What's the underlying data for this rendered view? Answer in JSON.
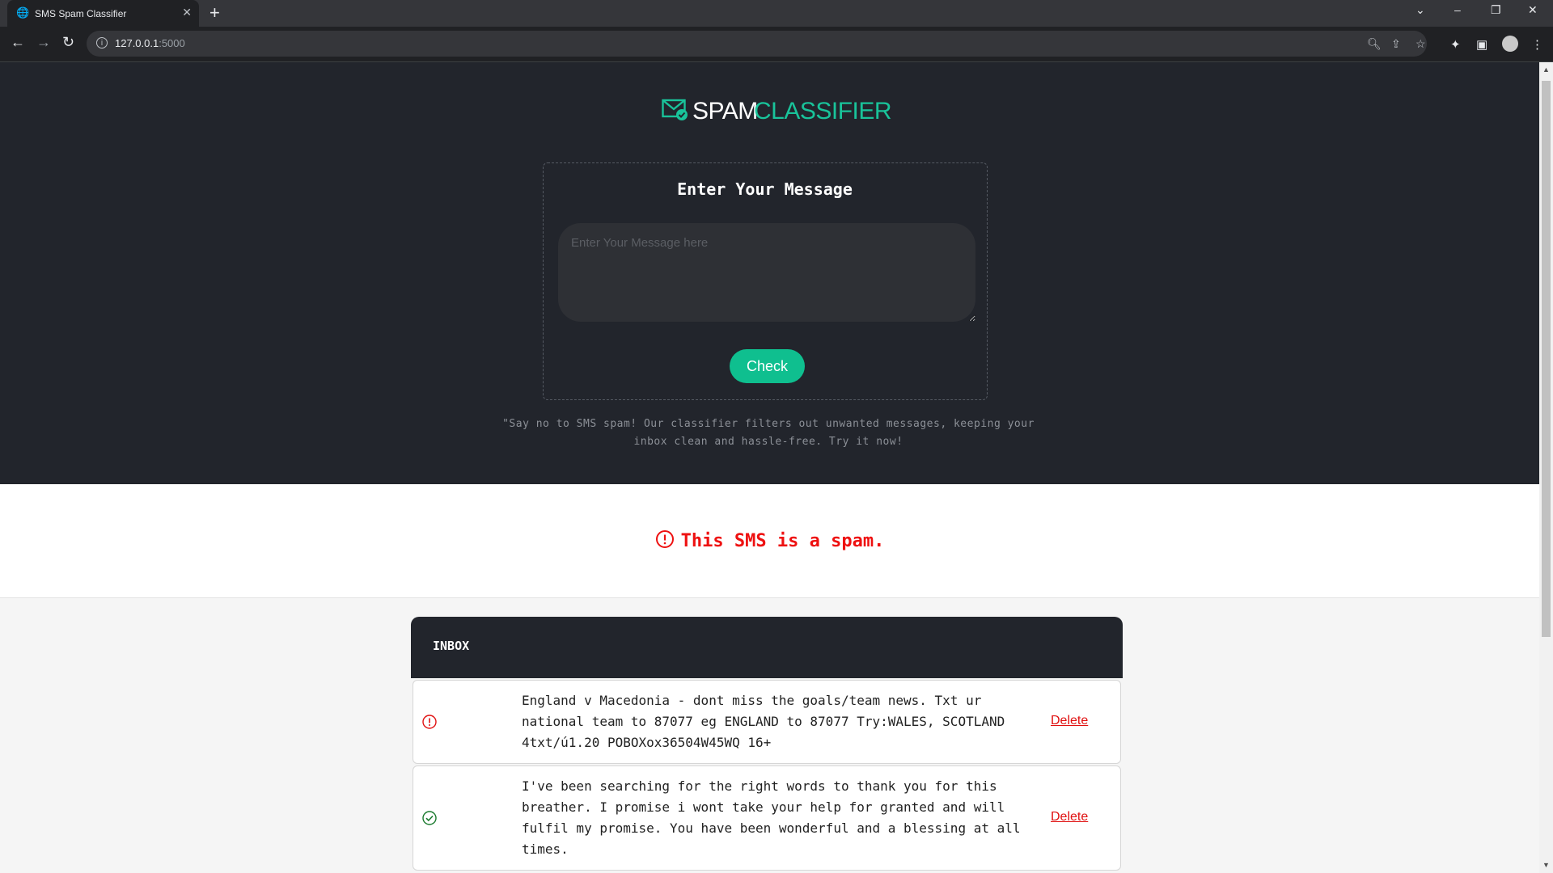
{
  "browser": {
    "tab_title": "SMS Spam Classifier",
    "url_host": "127.0.0.1",
    "url_port": ":5000"
  },
  "logo": {
    "word1": "SPAM",
    "word2": "CLASSIFIER",
    "accent_color": "#19c39a"
  },
  "form": {
    "heading": "Enter Your Message",
    "placeholder": "Enter Your Message here",
    "check_label": "Check"
  },
  "tagline": "\"Say no to SMS spam! Our classifier filters out unwanted messages, keeping your inbox clean and hassle-free. Try it now!",
  "result": {
    "text": "This SMS is a spam.",
    "status": "spam",
    "color": "#ee1111"
  },
  "inbox": {
    "title": "INBOX",
    "messages": [
      {
        "status": "spam",
        "icon": "alert-circle-icon",
        "text": "England v Macedonia - dont miss the goals/team news. Txt ur national team to 87077 eg ENGLAND to 87077 Try:WALES, SCOTLAND 4txt/ú1.20 POBOXox36504W45WQ 16+",
        "delete_label": "Delete"
      },
      {
        "status": "ham",
        "icon": "check-circle-icon",
        "text": "I've been searching for the right words to thank you for this breather. I promise i wont take your help for granted and will fulfil my promise. You have been wonderful and a blessing at all times.",
        "delete_label": "Delete"
      }
    ]
  }
}
